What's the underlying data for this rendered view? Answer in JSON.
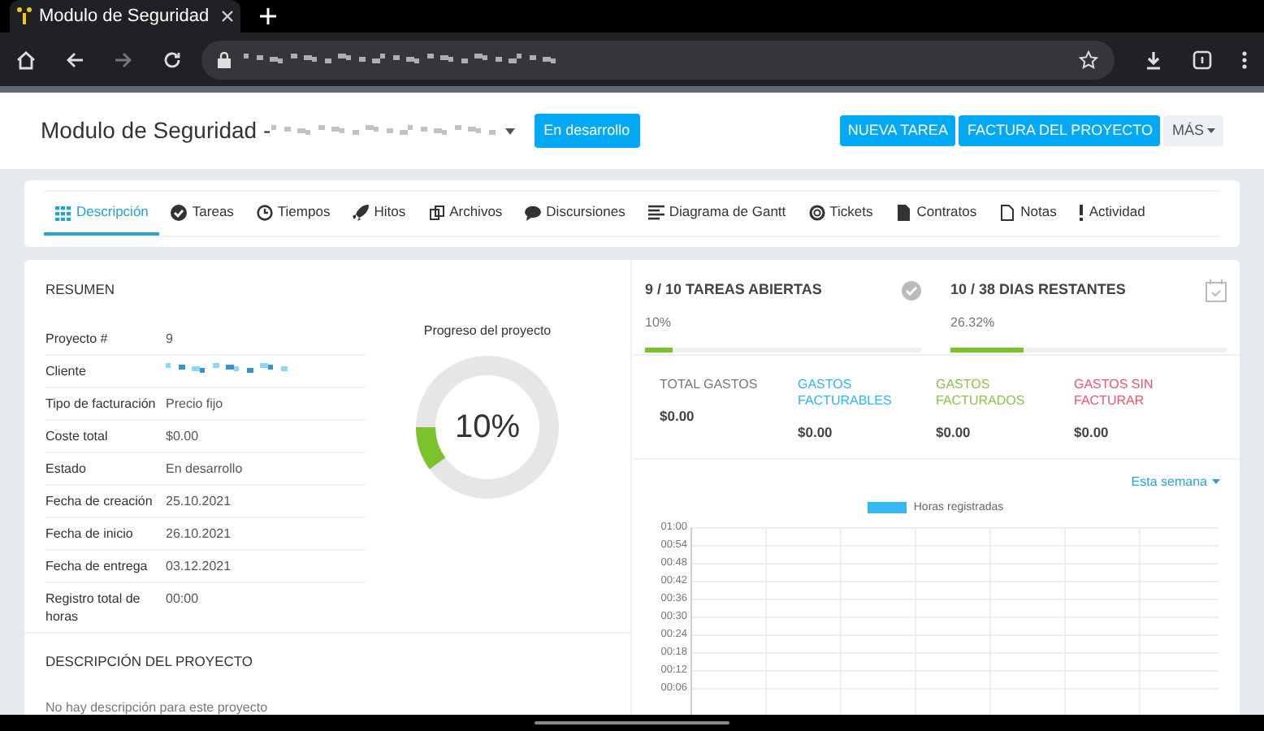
{
  "browser": {
    "tab_title": "Modulo de Seguridad"
  },
  "header": {
    "title": "Modulo de Seguridad -",
    "status_badge": "En desarrollo",
    "buttons": [
      "NUEVA TAREA",
      "FACTURA DEL PROYECTO"
    ],
    "more": "MÁS"
  },
  "tabs": [
    {
      "label": "Descripción",
      "selected": true
    },
    {
      "label": "Tareas",
      "selected": false
    },
    {
      "label": "Tiempos",
      "selected": false
    },
    {
      "label": "Hitos",
      "selected": false
    },
    {
      "label": "Archivos",
      "selected": false
    },
    {
      "label": "Discursiones",
      "selected": false
    },
    {
      "label": "Diagrama de Gantt",
      "selected": false
    },
    {
      "label": "Tickets",
      "selected": false
    },
    {
      "label": "Contratos",
      "selected": false
    },
    {
      "label": "Notas",
      "selected": false
    },
    {
      "label": "Actividad",
      "selected": false
    }
  ],
  "summary": {
    "title": "RESUMEN",
    "rows": [
      {
        "label": "Proyecto #",
        "value": "9"
      },
      {
        "label": "Cliente",
        "kind": "redacted"
      },
      {
        "label": "Tipo de facturación",
        "value": "Precio fijo"
      },
      {
        "label": "Coste total",
        "value": "$0.00"
      },
      {
        "label": "Estado",
        "value": "En desarrollo"
      },
      {
        "label": "Fecha de creación",
        "value": "25.10.2021"
      },
      {
        "label": "Fecha de inicio",
        "value": "26.10.2021"
      },
      {
        "label": "Fecha de entrega",
        "value": "03.12.2021"
      },
      {
        "label": "Registro total de horas",
        "value": "00:00"
      }
    ],
    "progress_title": "Progreso del proyecto",
    "progress_text": "10%",
    "level": 0.1
  },
  "description": {
    "title": "DESCRIPCIÓN DEL PROYECTO",
    "text": "No hay descripción para este proyecto"
  },
  "stats": [
    {
      "title": "9 / 10 TAREAS ABIERTAS",
      "reading": "10%",
      "level": 0.1
    },
    {
      "title": "10 / 38 DIAS RESTANTES",
      "reading": "26.32%",
      "level": 0.2632
    }
  ],
  "expenses": [
    {
      "label": "TOTAL GASTOS",
      "value": "$0.00",
      "color": "#777777"
    },
    {
      "label": "GASTOS FACTURABLES",
      "value": "$0.00",
      "color": "#29b6f6"
    },
    {
      "label": "GASTOS FACTURADOS",
      "value": "$0.00",
      "color": "#8bc34a"
    },
    {
      "label": "GASTOS SIN FACTURAR",
      "value": "$0.00",
      "color": "#ef5370"
    }
  ],
  "chart": {
    "period": "Esta semana",
    "chart_data": {
      "type": "bar",
      "grid": true,
      "series": [
        {
          "name": "Horas registradas",
          "color": "#36b9f2",
          "values": [
            0,
            0,
            0,
            0,
            0,
            0,
            0
          ]
        }
      ],
      "ylim": [
        0,
        60
      ],
      "yticks": [
        {
          "value": 6,
          "label": "00:06"
        },
        {
          "value": 12,
          "label": "00:12"
        },
        {
          "value": 18,
          "label": "00:18"
        },
        {
          "value": 24,
          "label": "00:24"
        },
        {
          "value": 30,
          "label": "00:30"
        },
        {
          "value": 36,
          "label": "00:36"
        },
        {
          "value": 42,
          "label": "00:42"
        },
        {
          "value": 48,
          "label": "00:48"
        },
        {
          "value": 54,
          "label": "00:54"
        },
        {
          "value": 60,
          "label": "01:00"
        }
      ]
    }
  }
}
